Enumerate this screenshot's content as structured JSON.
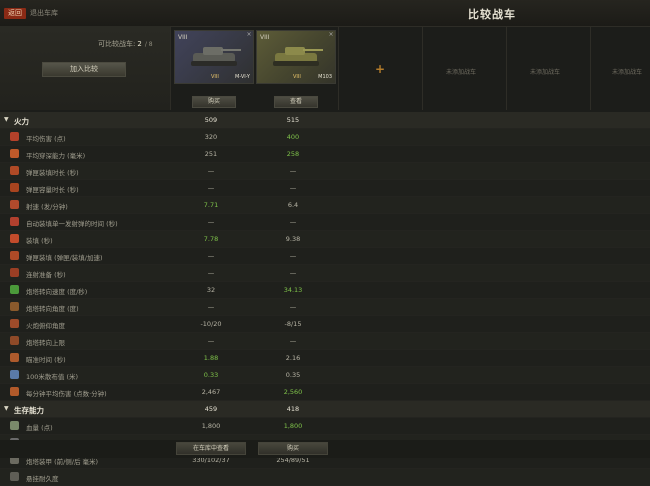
{
  "header": {
    "back_label": "返回",
    "breadcrumb": "退出车库",
    "title": "比较战车"
  },
  "left_panel": {
    "count_label": "可比较战车:",
    "count_value": "2",
    "count_max": "/ 8",
    "add_button": "加入比较"
  },
  "vehicles": [
    {
      "tier": "VIII",
      "name": "M-VI-Y",
      "level": "VIII",
      "control": "购买",
      "color": "#41435a"
    },
    {
      "tier": "VIII",
      "name": "M103",
      "level": "VIII",
      "control": "查看",
      "color": "#5d5c38"
    }
  ],
  "empty_slots": [
    "未添加战车",
    "未添加战车",
    "未添加战车"
  ],
  "rows": [
    {
      "type": "section",
      "label": "火力",
      "v1": "509",
      "v2": "515"
    },
    {
      "type": "row",
      "label": "平均伤害 (点)",
      "v1": "320",
      "v2": "400",
      "v2green": true,
      "icon": "#b4412a"
    },
    {
      "type": "row",
      "label": "平均穿深能力 (毫米)",
      "v1": "251",
      "v2": "258",
      "v2green": true,
      "icon": "#c05a2a"
    },
    {
      "type": "row",
      "label": "弹匣装填时长 (秒)",
      "v1": "—",
      "v2": "—",
      "icon": "#b04a26"
    },
    {
      "type": "row",
      "label": "弹匣容量时长 (秒)",
      "v1": "—",
      "v2": "—",
      "icon": "#a8441f"
    },
    {
      "type": "row",
      "label": "射速 (发/分钟)",
      "v1": "7.71",
      "v1green": true,
      "v2": "6.4",
      "icon": "#b14a2c"
    },
    {
      "type": "row",
      "label": "自动装填单一发射弹的时间 (秒)",
      "v1": "—",
      "v2": "—",
      "icon": "#b2402e"
    },
    {
      "type": "row",
      "label": "装填 (秒)",
      "v1": "7.78",
      "v1green": true,
      "v2": "9.38",
      "icon": "#c24b2b"
    },
    {
      "type": "row",
      "label": "弹匣装填 (弹匣/装填/加速)",
      "v1": "—",
      "v2": "—",
      "icon": "#ad4a27"
    },
    {
      "type": "row",
      "label": "连射准备 (秒)",
      "v1": "—",
      "v2": "—",
      "icon": "#9a3e24"
    },
    {
      "type": "row",
      "label": "炮塔转向速度 (度/秒)",
      "v1": "32",
      "v2": "34.13",
      "v2green": true,
      "icon": "#4b9a3a"
    },
    {
      "type": "row",
      "label": "炮塔转向角度 (度)",
      "v1": "—",
      "v2": "—",
      "icon": "#8a5a2c"
    },
    {
      "type": "row",
      "label": "火炮俯仰角度",
      "v1": "-10/20",
      "v2": "-8/15",
      "icon": "#9d4b2a"
    },
    {
      "type": "row",
      "label": "炮塔转向上限",
      "v1": "—",
      "v2": "—",
      "icon": "#8f4a28"
    },
    {
      "type": "row",
      "label": "瞄准时间 (秒)",
      "v1": "1.88",
      "v1green": true,
      "v2": "2.16",
      "icon": "#ad5a2c"
    },
    {
      "type": "row",
      "label": "100米散布值 (米)",
      "v1": "0.33",
      "v1green": true,
      "v2": "0.35",
      "icon": "#5a7aa8"
    },
    {
      "type": "row",
      "label": "每分钟平均伤害 (点数·分钟)",
      "v1": "2,467",
      "v2": "2,560",
      "v2green": true,
      "icon": "#b25a2a"
    },
    {
      "type": "section",
      "label": "生存能力",
      "v1": "459",
      "v1green": true,
      "v2": "418"
    },
    {
      "type": "row",
      "label": "血量 (点)",
      "v1": "1,800",
      "v2": "1,800",
      "v2green": true,
      "icon": "#7a8a6a"
    },
    {
      "type": "row",
      "label": "车体装甲 (前/侧/后 毫米)",
      "v1": "165/89/38",
      "v2": "229/45/45",
      "v2green": true,
      "icon": "#6a6a6a"
    },
    {
      "type": "row",
      "label": "炮塔装甲 (前/侧/后 毫米)",
      "v1": "330/102/37",
      "v2": "254/89/51",
      "icon": "#6b6a60"
    },
    {
      "type": "row",
      "label": "悬挂耐久度",
      "v1": "",
      "v2": "",
      "icon": "#5f5e56"
    }
  ],
  "bottom_buttons": [
    "在车库中查看",
    "购买"
  ]
}
